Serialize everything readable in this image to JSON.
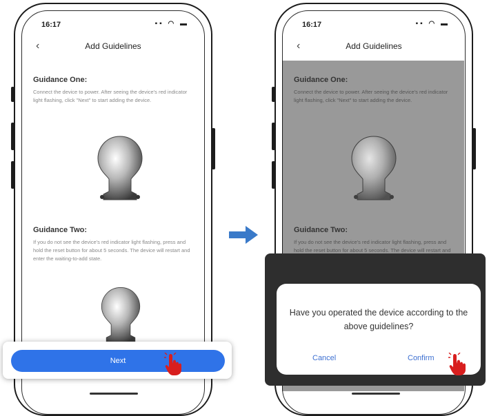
{
  "status_bar": {
    "time": "16:17",
    "icons": "signal-icon wifi-icon battery-icon"
  },
  "nav": {
    "title": "Add Guidelines",
    "back_icon": "chevron-left-icon"
  },
  "guidance_one": {
    "title": "Guidance One:",
    "text": "Connect the device to power. After seeing the device's red indicator light flashing, click \"Next\" to start adding the device."
  },
  "guidance_two": {
    "title": "Guidance Two:",
    "text": "If you do not see the device's red indicator light flashing, press and hold the reset button for about 5 seconds. The device will restart and enter the waiting-to-add state."
  },
  "next_button": {
    "label": "Next",
    "color": "#2f73e8"
  },
  "dialog": {
    "message": "Have you operated the device according to the above guidelines?",
    "cancel_label": "Cancel",
    "confirm_label": "Confirm",
    "action_color": "#3c6fd1"
  },
  "flow_arrow_color": "#3a7ac9",
  "pointer_color": "#d81e1e"
}
